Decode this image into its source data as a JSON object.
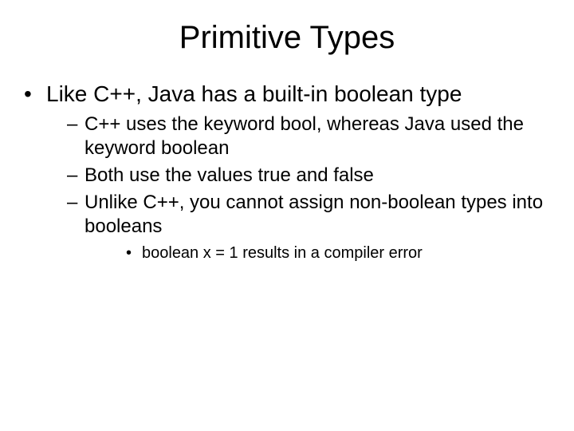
{
  "slide": {
    "title": "Primitive Types",
    "bullets": [
      {
        "text": "Like C++, Java has a built-in boolean type",
        "sub": [
          {
            "text": "C++ uses the keyword bool, whereas Java used the keyword boolean"
          },
          {
            "text": "Both use the values true and false"
          },
          {
            "text": "Unlike C++, you cannot assign non-boolean types into booleans",
            "sub": [
              {
                "text": "boolean x = 1 results in a compiler error"
              }
            ]
          }
        ]
      }
    ]
  }
}
